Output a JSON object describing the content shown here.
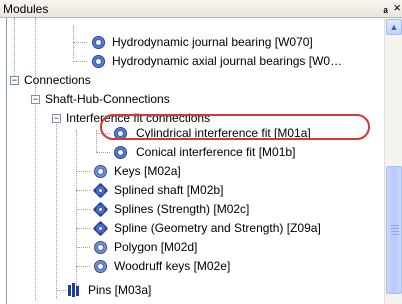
{
  "panel": {
    "title": "Modules",
    "pin_icon": "pin-icon",
    "close_label": "×"
  },
  "tree": {
    "items": [
      {
        "label": "Hydrodynamic journal bearing [W070]",
        "icon": "bearing-icon"
      },
      {
        "label": "Hydrodynamic axial journal bearings [W0…",
        "icon": "bearing-icon"
      },
      {
        "label": "Connections",
        "toggle": "−"
      },
      {
        "label": "Shaft-Hub-Connections",
        "toggle": "−"
      },
      {
        "label": "Interference fit connections",
        "toggle": "−"
      },
      {
        "label": "Cylindrical interference fit [M01a]",
        "icon": "interference-fit-icon"
      },
      {
        "label": "Conical interference fit [M01b]",
        "icon": "interference-fit-icon"
      },
      {
        "label": "Keys [M02a]",
        "icon": "key-icon"
      },
      {
        "label": "Splined shaft [M02b]",
        "icon": "spline-icon"
      },
      {
        "label": "Splines (Strength) [M02c]",
        "icon": "spline-icon"
      },
      {
        "label": "Spline (Geometry and Strength) [Z09a]",
        "icon": "spline-icon"
      },
      {
        "label": "Polygon [M02d]",
        "icon": "polygon-icon"
      },
      {
        "label": "Woodruff keys [M02e]",
        "icon": "woodruff-key-icon"
      },
      {
        "label": "Pins [M03a]",
        "icon": "pins-icon"
      }
    ]
  },
  "colors": {
    "highlight": "#d23a32",
    "selection": "#316ac5"
  }
}
